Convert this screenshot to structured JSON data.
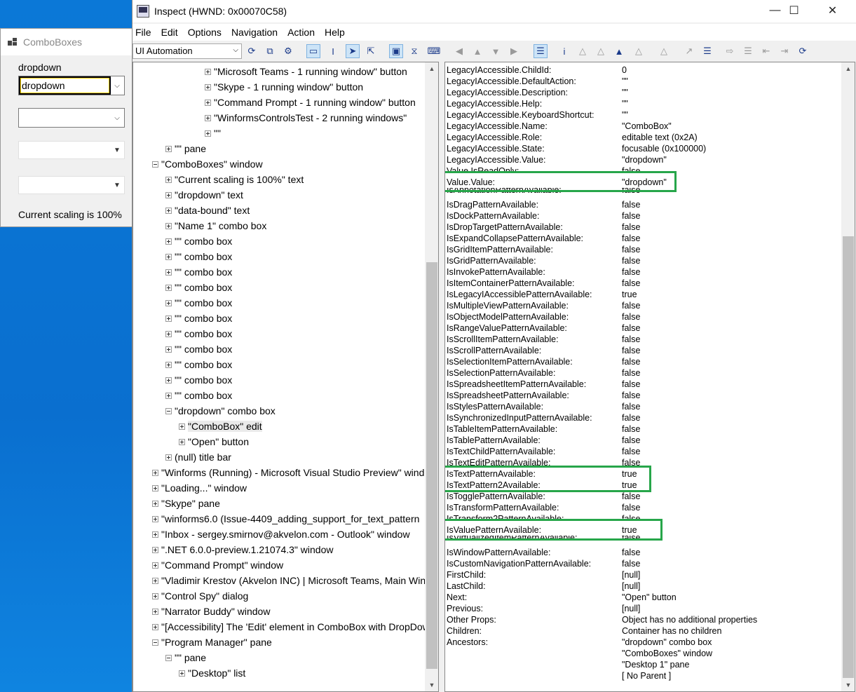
{
  "combobox_window": {
    "title": "ComboBoxes",
    "label": "dropdown",
    "combo1_value": "dropdown",
    "status": "Current scaling is 100%"
  },
  "inspect": {
    "title": "Inspect  (HWND: 0x00070C58)",
    "menu": [
      "File",
      "Edit",
      "Options",
      "Navigation",
      "Action",
      "Help"
    ],
    "mode": "UI Automation"
  },
  "tree": [
    {
      "label": "\"Microsoft Teams - 1 running window\" button"
    },
    {
      "label": "\"Skype - 1 running window\" button"
    },
    {
      "label": "\"Command Prompt - 1 running window\" button"
    },
    {
      "label": "\"WinformsControlsTest - 2 running windows\""
    },
    {
      "label": "\"\""
    },
    {
      "label": "\"\" pane"
    },
    {
      "label": "\"ComboBoxes\" window"
    },
    {
      "label": "\"Current scaling is 100%\" text"
    },
    {
      "label": "\"dropdown\" text"
    },
    {
      "label": "\"data-bound\" text"
    },
    {
      "label": "\"Name 1\" combo box"
    },
    {
      "label": "\"\" combo box"
    },
    {
      "label": "\"\" combo box"
    },
    {
      "label": "\"\" combo box"
    },
    {
      "label": "\"\" combo box"
    },
    {
      "label": "\"\" combo box"
    },
    {
      "label": "\"\" combo box"
    },
    {
      "label": "\"\" combo box"
    },
    {
      "label": "\"\" combo box"
    },
    {
      "label": "\"\" combo box"
    },
    {
      "label": "\"\" combo box"
    },
    {
      "label": "\"\" combo box"
    },
    {
      "label": "\"dropdown\" combo box"
    },
    {
      "label": "\"ComboBox\" edit"
    },
    {
      "label": "\"Open\" button"
    },
    {
      "label": "(null) title bar"
    },
    {
      "label": "\"Winforms (Running) - Microsoft Visual Studio Preview\" window"
    },
    {
      "label": "\"Loading...\" window"
    },
    {
      "label": "\"Skype\" pane"
    },
    {
      "label": "\"winforms6.0 (Issue-4409_adding_support_for_text_pattern"
    },
    {
      "label": "\"Inbox - sergey.smirnov@akvelon.com - Outlook\" window"
    },
    {
      "label": "\".NET 6.0.0-preview.1.21074.3\" window"
    },
    {
      "label": "\"Command Prompt\" window"
    },
    {
      "label": "\"Vladimir Krestov (Akvelon INC) | Microsoft Teams, Main Window"
    },
    {
      "label": "\"Control Spy\" dialog"
    },
    {
      "label": "\"Narrator Buddy\" window"
    },
    {
      "label": "\"[Accessibility] The 'Edit' element in ComboBox with DropDown"
    },
    {
      "label": "\"Program Manager\" pane"
    },
    {
      "label": "\"\" pane"
    },
    {
      "label": "\"Desktop\" list"
    }
  ],
  "props": [
    {
      "k": "LegacyIAccessible.ChildId:",
      "v": "0"
    },
    {
      "k": "LegacyIAccessible.DefaultAction:",
      "v": "\"\""
    },
    {
      "k": "LegacyIAccessible.Description:",
      "v": "\"\""
    },
    {
      "k": "LegacyIAccessible.Help:",
      "v": "\"\""
    },
    {
      "k": "LegacyIAccessible.KeyboardShortcut:",
      "v": "\"\""
    },
    {
      "k": "LegacyIAccessible.Name:",
      "v": "\"ComboBox\""
    },
    {
      "k": "LegacyIAccessible.Role:",
      "v": "editable text (0x2A)"
    },
    {
      "k": "LegacyIAccessible.State:",
      "v": "focusable (0x100000)"
    },
    {
      "k": "LegacyIAccessible.Value:",
      "v": "\"dropdown\""
    },
    {
      "k": "Value.IsReadOnly:",
      "v": "false"
    },
    {
      "k": "Value.Value:",
      "v": "\"dropdown\""
    },
    {
      "k": "IsAnnotationPatternAvailable:",
      "v": "false"
    },
    {
      "k": "IsDragPatternAvailable:",
      "v": "false"
    },
    {
      "k": "IsDockPatternAvailable:",
      "v": "false"
    },
    {
      "k": "IsDropTargetPatternAvailable:",
      "v": "false"
    },
    {
      "k": "IsExpandCollapsePatternAvailable:",
      "v": "false"
    },
    {
      "k": "IsGridItemPatternAvailable:",
      "v": "false"
    },
    {
      "k": "IsGridPatternAvailable:",
      "v": "false"
    },
    {
      "k": "IsInvokePatternAvailable:",
      "v": "false"
    },
    {
      "k": "IsItemContainerPatternAvailable:",
      "v": "false"
    },
    {
      "k": "IsLegacyIAccessiblePatternAvailable:",
      "v": "true"
    },
    {
      "k": "IsMultipleViewPatternAvailable:",
      "v": "false"
    },
    {
      "k": "IsObjectModelPatternAvailable:",
      "v": "false"
    },
    {
      "k": "IsRangeValuePatternAvailable:",
      "v": "false"
    },
    {
      "k": "IsScrollItemPatternAvailable:",
      "v": "false"
    },
    {
      "k": "IsScrollPatternAvailable:",
      "v": "false"
    },
    {
      "k": "IsSelectionItemPatternAvailable:",
      "v": "false"
    },
    {
      "k": "IsSelectionPatternAvailable:",
      "v": "false"
    },
    {
      "k": "IsSpreadsheetItemPatternAvailable:",
      "v": "false"
    },
    {
      "k": "IsSpreadsheetPatternAvailable:",
      "v": "false"
    },
    {
      "k": "IsStylesPatternAvailable:",
      "v": "false"
    },
    {
      "k": "IsSynchronizedInputPatternAvailable:",
      "v": "false"
    },
    {
      "k": "IsTableItemPatternAvailable:",
      "v": "false"
    },
    {
      "k": "IsTablePatternAvailable:",
      "v": "false"
    },
    {
      "k": "IsTextChildPatternAvailable:",
      "v": "false"
    },
    {
      "k": "IsTextEditPatternAvailable:",
      "v": "false"
    },
    {
      "k": "IsTextPatternAvailable:",
      "v": "true"
    },
    {
      "k": "IsTextPattern2Available:",
      "v": "true"
    },
    {
      "k": "IsTogglePatternAvailable:",
      "v": "false"
    },
    {
      "k": "IsTransformPatternAvailable:",
      "v": "false"
    },
    {
      "k": "IsTransform2PatternAvailable:",
      "v": "false"
    },
    {
      "k": "IsValuePatternAvailable:",
      "v": "true"
    },
    {
      "k": "IsVirtualizedItemPatternAvailable:",
      "v": "false"
    },
    {
      "k": "IsWindowPatternAvailable:",
      "v": "false"
    },
    {
      "k": "IsCustomNavigationPatternAvailable:",
      "v": "false"
    },
    {
      "k": "FirstChild:",
      "v": "[null]"
    },
    {
      "k": "LastChild:",
      "v": "[null]"
    },
    {
      "k": "Next:",
      "v": "\"Open\" button"
    },
    {
      "k": "Previous:",
      "v": "[null]"
    },
    {
      "k": "Other Props:",
      "v": "Object has no additional properties"
    },
    {
      "k": "Children:",
      "v": "Container has no children"
    },
    {
      "k": "Ancestors:",
      "v": "\"dropdown\" combo box"
    },
    {
      "k": "",
      "v": "\"ComboBoxes\" window"
    },
    {
      "k": "",
      "v": "\"Desktop 1\" pane"
    },
    {
      "k": "",
      "v": "[ No Parent ]"
    }
  ]
}
